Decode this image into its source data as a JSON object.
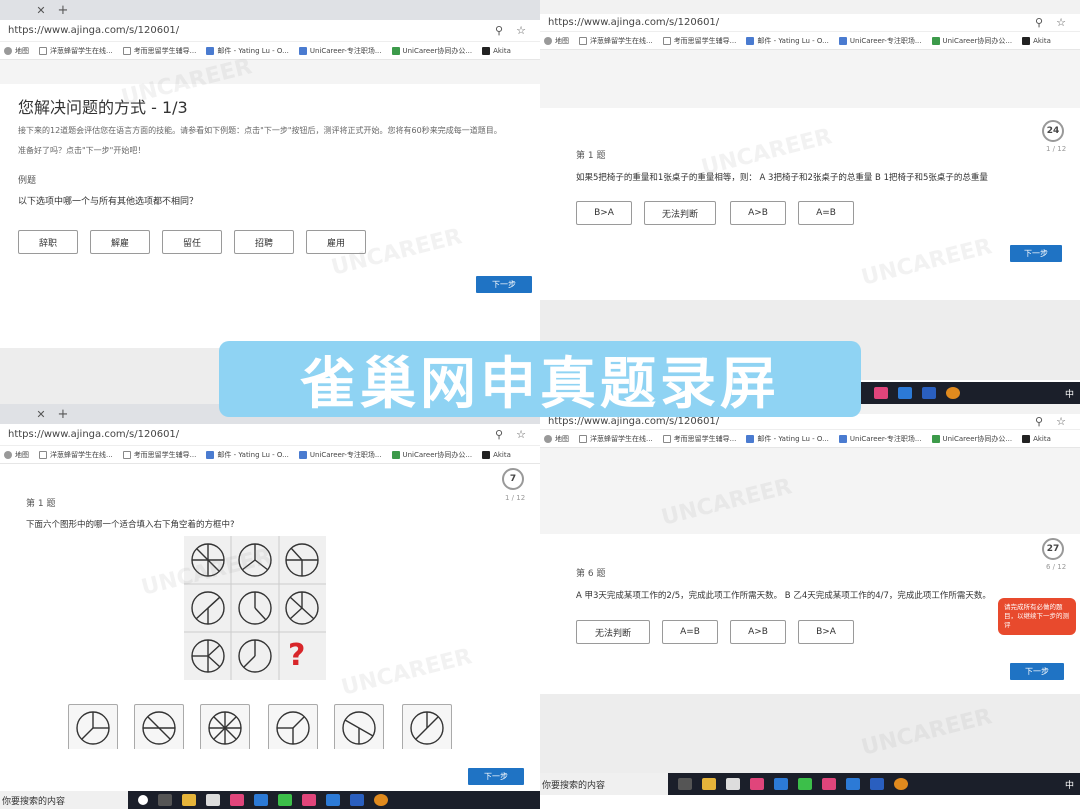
{
  "browser": {
    "url": "https://www.ajinga.com/s/120601/",
    "bookmarks": [
      "地图",
      "洋葱蜂留学生在线...",
      "考而思留学生辅导...",
      "邮件 - Yating Lu - O...",
      "UniCareer-专注职场...",
      "UniCareer协同办公...",
      "Akita"
    ]
  },
  "banner_text": "雀巢网申真题录屏",
  "watermark": "UNCAREER",
  "panel1": {
    "title": "您解决问题的方式 - 1/3",
    "intro": "接下来的12道题会评估您在语言方面的技能。请参看如下例题：点击\"下一步\"按钮后，测评将正式开始。您将有60秒来完成每一道题目。",
    "ready": "准备好了吗？点击\"下一步\"开始吧！",
    "example_label": "例题",
    "question": "以下选项中哪一个与所有其他选项都不相同？",
    "options": [
      "辞职",
      "解雇",
      "留任",
      "招聘",
      "雇用"
    ],
    "next": "下一步"
  },
  "panel2": {
    "timer": "24",
    "count": "1 / 12",
    "qno": "第 1 题",
    "question": "如果5把椅子的重量和1张桌子的重量相等，则： A 3把椅子和2张桌子的总重量 B 1把椅子和5张桌子的总重量",
    "options": [
      "B>A",
      "无法判断",
      "A>B",
      "A=B"
    ],
    "next": "下一步"
  },
  "panel3": {
    "timer": "7",
    "count": "1 / 12",
    "qno": "第 1 题",
    "question": "下面六个图形中的哪一个适合填入右下角空着的方框中?",
    "missing": "?",
    "next": "下一步",
    "search": "你要搜索的内容"
  },
  "panel4": {
    "timer": "27",
    "count": "6 / 12",
    "qno": "第 6 题",
    "question": "A 甲3天完成某项工作的2/5，完成此项工作所需天数。 B 乙4天完成某项工作的4/7，完成此项工作所需天数。",
    "options": [
      "无法判断",
      "A=B",
      "A>B",
      "B>A"
    ],
    "tip": "请完成所有必做的题目，以继续下一步的测评",
    "next": "下一步",
    "search": "你要搜索的内容",
    "clock": "中"
  },
  "colors": {
    "accent": "#1f73c4",
    "banner": "#8fd3f3",
    "tip": "#e84a2d"
  }
}
